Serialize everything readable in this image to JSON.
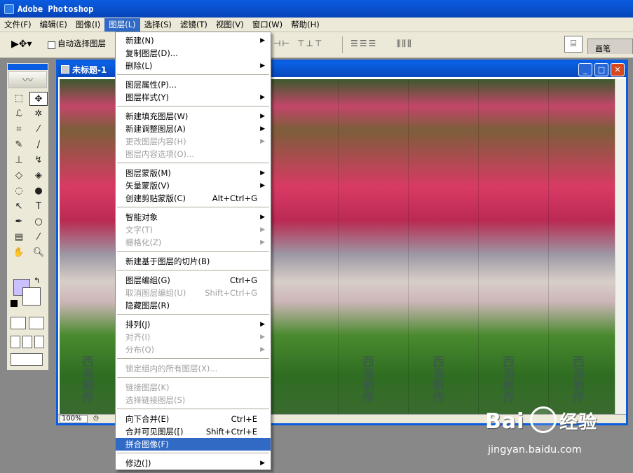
{
  "app": {
    "title": "Adobe Photoshop"
  },
  "menubar": {
    "items": [
      "文件(F)",
      "编辑(E)",
      "图像(I)",
      "图层(L)",
      "选择(S)",
      "滤镜(T)",
      "视图(V)",
      "窗口(W)",
      "帮助(H)"
    ]
  },
  "options": {
    "auto_select_label": "自动选择图层",
    "brush_tab": "画笔"
  },
  "document": {
    "title": "未标题-1",
    "zoom": "100%"
  },
  "watermark": {
    "chars": [
      "西",
      "海",
      "剩",
      "传"
    ]
  },
  "layer_menu": {
    "items": [
      {
        "label": "新建(N)",
        "submenu": true
      },
      {
        "label": "复制图层(D)..."
      },
      {
        "label": "删除(L)",
        "submenu": true
      },
      {
        "label": "图层属性(P)..."
      },
      {
        "label": "图层样式(Y)",
        "submenu": true
      },
      {
        "label": "新建填充图层(W)",
        "submenu": true
      },
      {
        "label": "新建调整图层(A)",
        "submenu": true
      },
      {
        "label": "更改图层内容(H)",
        "submenu": true,
        "disabled": true
      },
      {
        "label": "图层内容选项(O)...",
        "disabled": true
      },
      {
        "label": "图层蒙版(M)",
        "submenu": true
      },
      {
        "label": "矢量蒙版(V)",
        "submenu": true
      },
      {
        "label": "创建剪贴蒙版(C)",
        "shortcut": "Alt+Ctrl+G"
      },
      {
        "label": "智能对象",
        "submenu": true
      },
      {
        "label": "文字(T)",
        "submenu": true,
        "disabled": true
      },
      {
        "label": "栅格化(Z)",
        "submenu": true,
        "disabled": true
      },
      {
        "label": "新建基于图层的切片(B)"
      },
      {
        "label": "图层编组(G)",
        "shortcut": "Ctrl+G"
      },
      {
        "label": "取消图层编组(U)",
        "shortcut": "Shift+Ctrl+G",
        "disabled": true
      },
      {
        "label": "隐藏图层(R)"
      },
      {
        "label": "排列(J)",
        "submenu": true
      },
      {
        "label": "对齐(I)",
        "submenu": true,
        "disabled": true
      },
      {
        "label": "分布(Q)",
        "submenu": true,
        "disabled": true
      },
      {
        "label": "锁定组内的所有图层(X)...",
        "disabled": true
      },
      {
        "label": "链接图层(K)",
        "disabled": true
      },
      {
        "label": "选择链接图层(S)",
        "disabled": true
      },
      {
        "label": "向下合并(E)",
        "shortcut": "Ctrl+E"
      },
      {
        "label": "合并可见图层([)",
        "shortcut": "Shift+Ctrl+E"
      },
      {
        "label": "拼合图像(F)",
        "highlighted": true
      },
      {
        "label": "修边(])",
        "submenu": true
      }
    ]
  },
  "brand": {
    "logo": "Bai",
    "logo2": "经验",
    "url": "jingyan.baidu.com"
  }
}
